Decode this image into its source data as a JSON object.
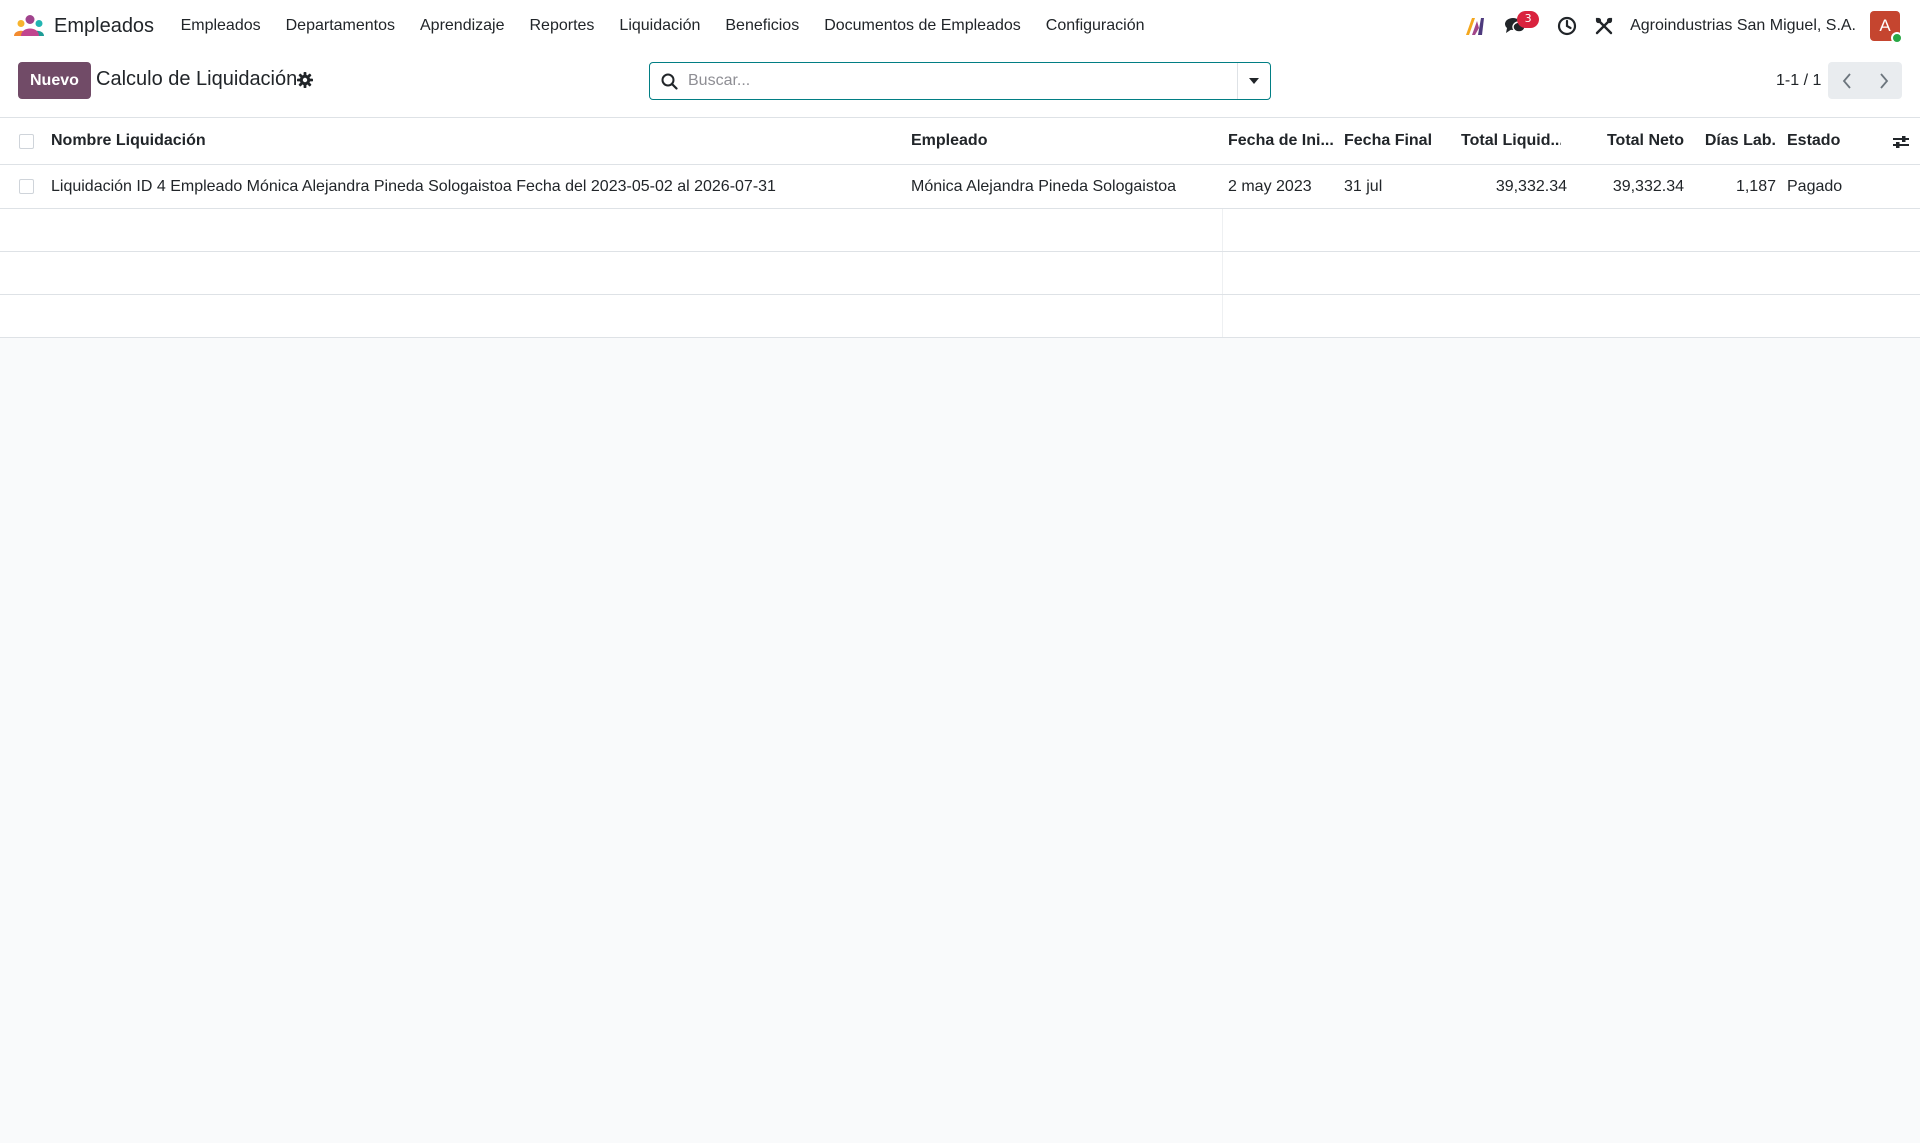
{
  "app": {
    "name": "Empleados",
    "logo_icon": "people-icon"
  },
  "nav": {
    "menu": [
      {
        "label": "Empleados"
      },
      {
        "label": "Departamentos"
      },
      {
        "label": "Aprendizaje"
      },
      {
        "label": "Reportes"
      },
      {
        "label": "Liquidación"
      },
      {
        "label": "Beneficios"
      },
      {
        "label": "Documentos de Empleados"
      },
      {
        "label": "Configuración"
      }
    ],
    "systray": {
      "messages_count": "3",
      "company": "Agroindustrias San Miguel, S.A.",
      "avatar_initial": "A"
    }
  },
  "control": {
    "new_label": "Nuevo",
    "title": "Calculo de Liquidación",
    "search_placeholder": "Buscar...",
    "pager_value": "1-1 / 1"
  },
  "table": {
    "columns": {
      "name": "Nombre Liquidación",
      "employee": "Empleado",
      "start": "Fecha de Ini...",
      "end": "Fecha Final",
      "total": "Total Liquid...",
      "net": "Total Neto",
      "days": "Días Lab.",
      "state": "Estado"
    },
    "rows": [
      {
        "name": "Liquidación ID 4 Empleado Mónica Alejandra Pineda Sologaistoa Fecha del 2023-05-02 al 2026-07-31",
        "employee": "Mónica Alejandra Pineda Sologaistoa",
        "start": "2 may 2023",
        "end": "31 jul",
        "total": "39,332.34",
        "net": "39,332.34",
        "days": "1,187",
        "state": "Pagado"
      }
    ]
  },
  "colors": {
    "primary": "#714b67",
    "search_border": "#017e84",
    "badge": "#d9233e",
    "avatar": "#c5452f",
    "online": "#28a745"
  }
}
